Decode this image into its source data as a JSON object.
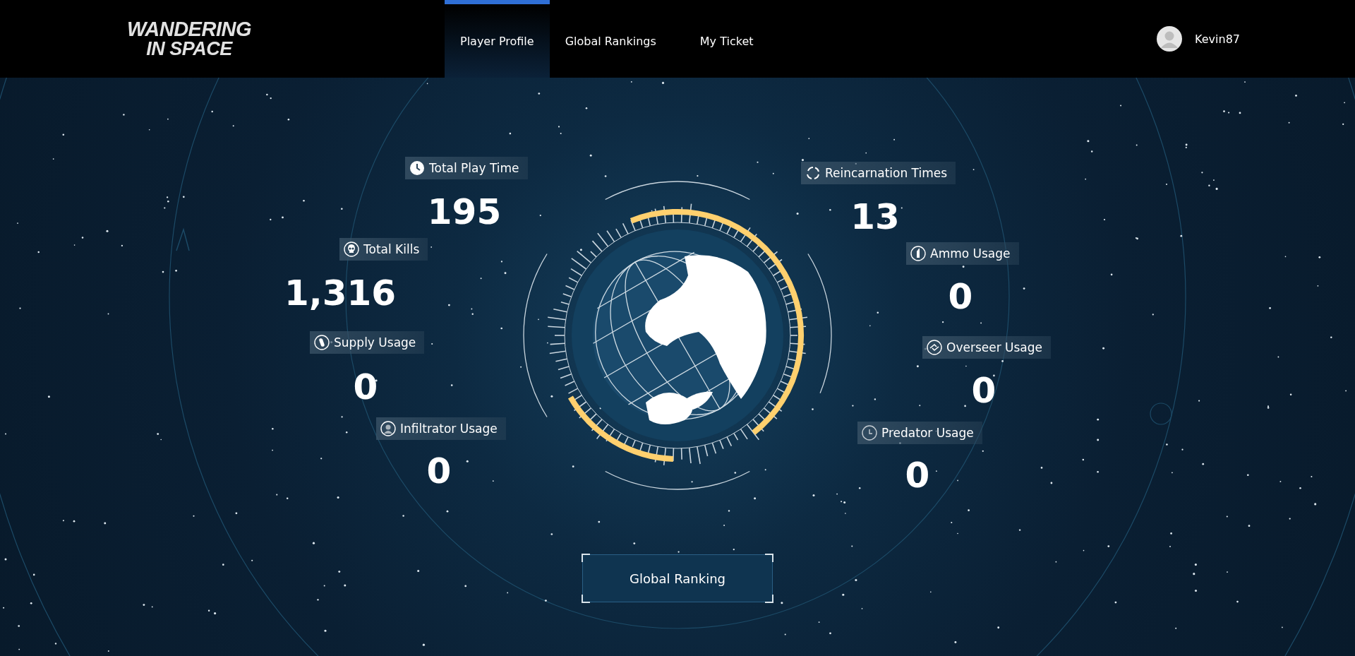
{
  "header": {
    "logo": {
      "line_1": "WANDERING",
      "line_2": "IN SPACE"
    },
    "nav": [
      {
        "label": "Player Profile",
        "selected": true
      },
      {
        "label": "Global Rankings",
        "selected": false
      },
      {
        "label": "My Ticket",
        "selected": false
      }
    ],
    "user": {
      "name": "Kevin87"
    }
  },
  "stats": [
    {
      "label": "Total Play Time",
      "value": "195"
    },
    {
      "label": "Total Kills",
      "value": "1,316"
    },
    {
      "label": "Supply Usage",
      "value": "0"
    },
    {
      "label": "Infiltrator Usage",
      "value": "0"
    },
    {
      "label": "Reincarnation Times",
      "value": "13"
    },
    {
      "label": "Ammo Usage",
      "value": "0"
    },
    {
      "label": "Overseer Usage",
      "value": "0"
    },
    {
      "label": "Predator Usage",
      "value": "0"
    }
  ],
  "button": {
    "label": "Global Ranking"
  }
}
